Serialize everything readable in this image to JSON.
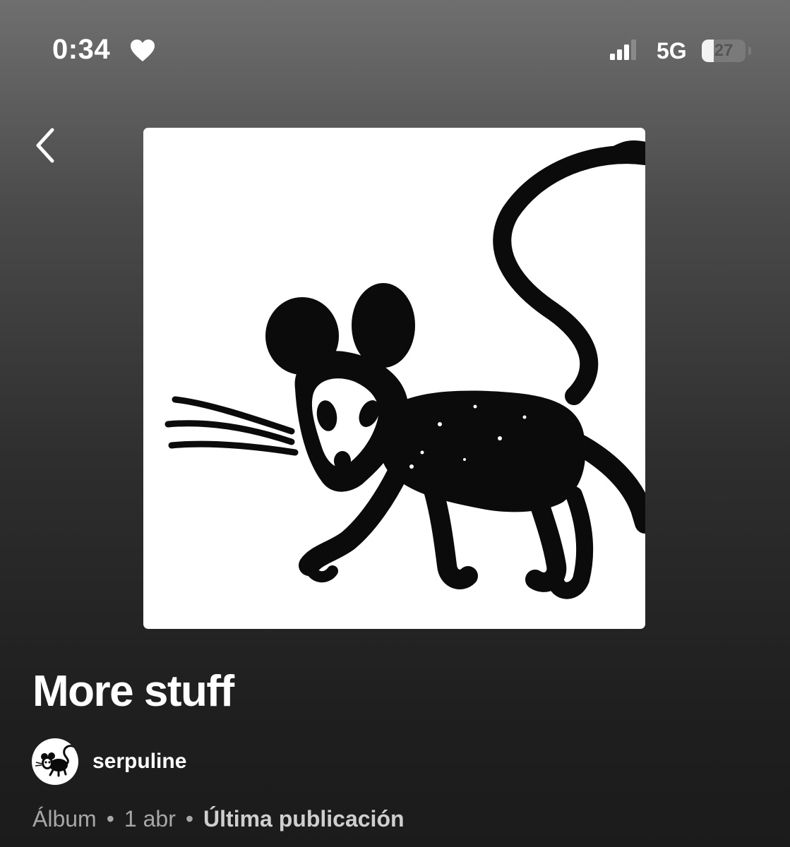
{
  "status_bar": {
    "time": "0:34",
    "heart_icon": "heart-icon",
    "signal_icon": "cellular-signal-icon",
    "network": "5G",
    "battery_level": "27",
    "battery_fraction": 0.27
  },
  "nav": {
    "back_icon": "chevron-left-icon"
  },
  "album": {
    "cover_art": "mouse-illustration-cover",
    "title": "More stuff",
    "artist": "serpuline",
    "type": "Álbum",
    "separator": "•",
    "date": "1 abr",
    "release_label": "Última publicación"
  }
}
